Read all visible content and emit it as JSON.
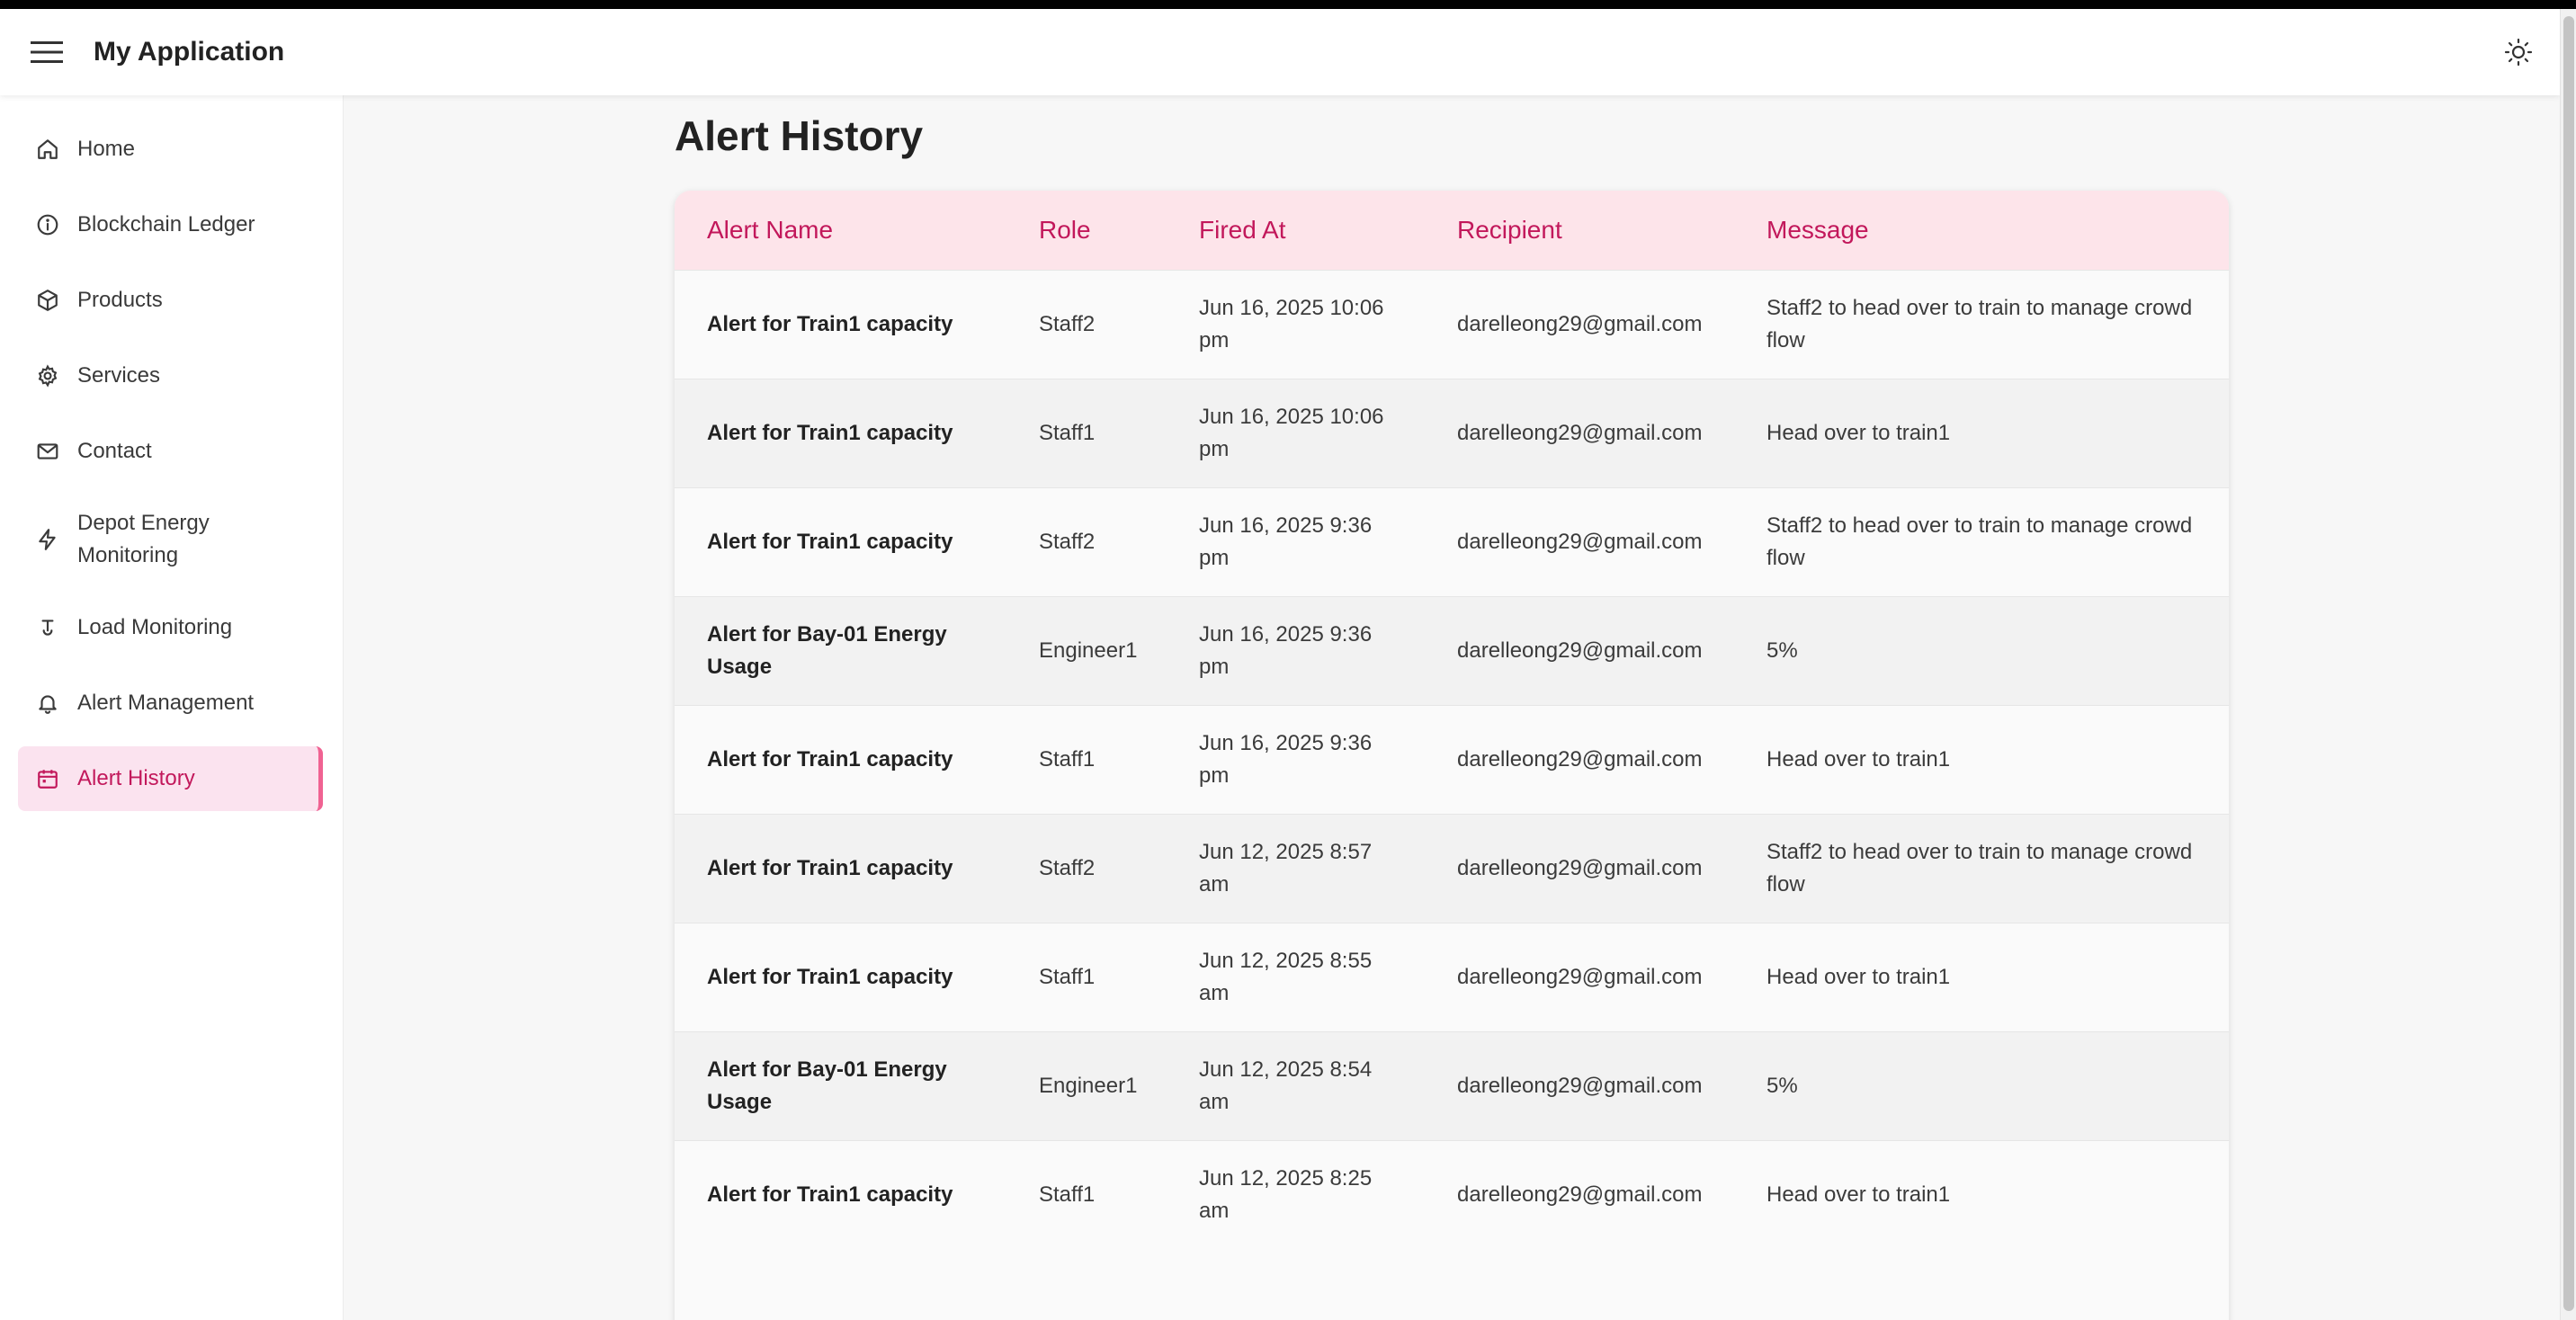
{
  "app": {
    "title": "My Application",
    "menu_icon": "hamburger-menu-icon",
    "theme_icon": "sun-icon"
  },
  "colors": {
    "accent": "#c2185b",
    "header_bg": "#fde4ea",
    "active_nav_bg": "#fbe3ef"
  },
  "sidebar": {
    "items": [
      {
        "label": "Home",
        "icon": "home-icon",
        "active": false
      },
      {
        "label": "Blockchain Ledger",
        "icon": "info-icon",
        "active": false
      },
      {
        "label": "Products",
        "icon": "box-icon",
        "active": false
      },
      {
        "label": "Services",
        "icon": "gear-icon",
        "active": false
      },
      {
        "label": "Contact",
        "icon": "mail-icon",
        "active": false
      },
      {
        "label": "Depot Energy Monitoring",
        "icon": "lightning-icon",
        "active": false
      },
      {
        "label": "Load Monitoring",
        "icon": "weight-icon",
        "active": false
      },
      {
        "label": "Alert Management",
        "icon": "bell-icon",
        "active": false
      },
      {
        "label": "Alert History",
        "icon": "calendar-icon",
        "active": true
      }
    ]
  },
  "main": {
    "title": "Alert History",
    "table": {
      "columns": [
        "Alert Name",
        "Role",
        "Fired At",
        "Recipient",
        "Message"
      ],
      "rows": [
        [
          "Alert for Train1 capacity",
          "Staff2",
          "Jun 16, 2025 10:06 pm",
          "darelleong29@gmail.com",
          "Staff2 to head over to train to manage crowd flow"
        ],
        [
          "Alert for Train1 capacity",
          "Staff1",
          "Jun 16, 2025 10:06 pm",
          "darelleong29@gmail.com",
          "Head over to train1"
        ],
        [
          "Alert for Train1 capacity",
          "Staff2",
          "Jun 16, 2025 9:36 pm",
          "darelleong29@gmail.com",
          "Staff2 to head over to train to manage crowd flow"
        ],
        [
          "Alert for Bay-01 Energy Usage",
          "Engineer1",
          "Jun 16, 2025 9:36 pm",
          "darelleong29@gmail.com",
          "5%"
        ],
        [
          "Alert for Train1 capacity",
          "Staff1",
          "Jun 16, 2025 9:36 pm",
          "darelleong29@gmail.com",
          "Head over to train1"
        ],
        [
          "Alert for Train1 capacity",
          "Staff2",
          "Jun 12, 2025 8:57 am",
          "darelleong29@gmail.com",
          "Staff2 to head over to train to manage crowd flow"
        ],
        [
          "Alert for Train1 capacity",
          "Staff1",
          "Jun 12, 2025 8:55 am",
          "darelleong29@gmail.com",
          "Head over to train1"
        ],
        [
          "Alert for Bay-01 Energy Usage",
          "Engineer1",
          "Jun 12, 2025 8:54 am",
          "darelleong29@gmail.com",
          "5%"
        ],
        [
          "Alert for Train1 capacity",
          "Staff1",
          "Jun 12, 2025 8:25 am",
          "darelleong29@gmail.com",
          "Head over to train1"
        ]
      ]
    }
  }
}
